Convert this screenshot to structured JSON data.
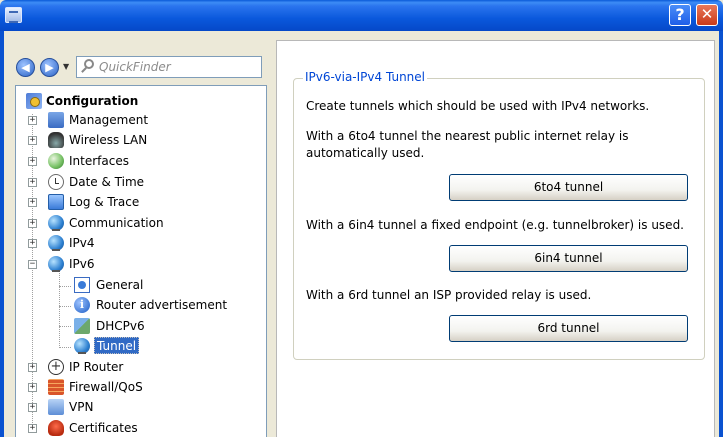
{
  "quickfinder": {
    "placeholder": "QuickFinder"
  },
  "tree": {
    "root": "Configuration",
    "items": [
      {
        "label": "Management",
        "icon": "management-icon"
      },
      {
        "label": "Wireless LAN",
        "icon": "wireless-lan-icon"
      },
      {
        "label": "Interfaces",
        "icon": "interfaces-icon"
      },
      {
        "label": "Date & Time",
        "icon": "clock-icon"
      },
      {
        "label": "Log & Trace",
        "icon": "log-icon"
      },
      {
        "label": "Communication",
        "icon": "globe-icon"
      },
      {
        "label": "IPv4",
        "icon": "globe-icon"
      },
      {
        "label": "IPv6",
        "icon": "globe-icon",
        "expanded": true
      },
      {
        "label": "IP Router",
        "icon": "router-icon"
      },
      {
        "label": "Firewall/QoS",
        "icon": "firewall-icon"
      },
      {
        "label": "VPN",
        "icon": "vpn-icon"
      },
      {
        "label": "Certificates",
        "icon": "certificate-icon"
      }
    ],
    "ipv6_children": [
      {
        "label": "General",
        "icon": "general-icon"
      },
      {
        "label": "Router advertisement",
        "icon": "info-icon"
      },
      {
        "label": "DHCPv6",
        "icon": "dhcp-icon"
      },
      {
        "label": "Tunnel",
        "icon": "globe-icon",
        "selected": true
      }
    ]
  },
  "main": {
    "group_title": "IPv6-via-IPv4 Tunnel",
    "intro": "Create tunnels which should be used with IPv4 networks.",
    "sixto4_text_line1": "With a 6to4 tunnel the nearest public internet relay is",
    "sixto4_text_line2": "automatically used.",
    "sixto4_button": "6to4 tunnel",
    "sixin4_text": "With a 6in4 tunnel a fixed endpoint (e.g. tunnelbroker) is used.",
    "sixin4_button": "6in4 tunnel",
    "sixrd_text": "With a 6rd tunnel an ISP provided relay is used.",
    "sixrd_button": "6rd tunnel"
  },
  "colors": {
    "titlebar": "#0a58dc",
    "selection": "#316ac5",
    "group_title": "#0046d5"
  }
}
